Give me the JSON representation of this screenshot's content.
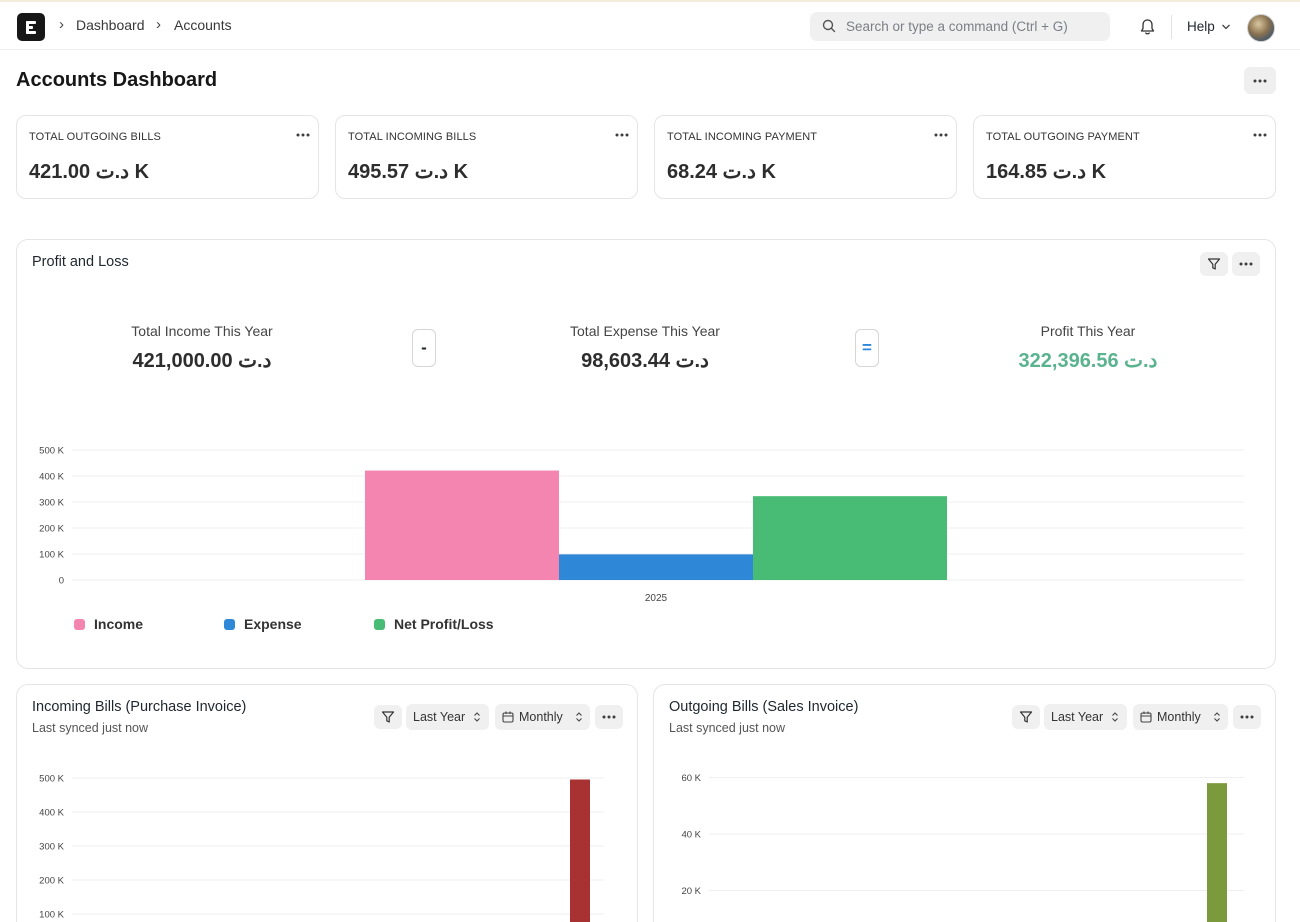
{
  "breadcrumb": {
    "items": [
      "Dashboard",
      "Accounts"
    ]
  },
  "search": {
    "placeholder": "Search or type a command (Ctrl + G)"
  },
  "header": {
    "help_label": "Help"
  },
  "page": {
    "title": "Accounts Dashboard"
  },
  "number_cards": [
    {
      "label": "TOTAL OUTGOING BILLS",
      "value": "421.00 د.ت K"
    },
    {
      "label": "TOTAL INCOMING BILLS",
      "value": "495.57 د.ت K"
    },
    {
      "label": "TOTAL INCOMING PAYMENT",
      "value": "68.24 د.ت K"
    },
    {
      "label": "TOTAL OUTGOING PAYMENT",
      "value": "164.85 د.ت K"
    }
  ],
  "profit_loss": {
    "title": "Profit and Loss",
    "income_label": "Total Income This Year",
    "income_value": "421,000.00 د.ت",
    "minus_sign": "-",
    "expense_label": "Total Expense This Year",
    "expense_value": "98,603.44 د.ت",
    "equals_sign": "=",
    "profit_label": "Profit This Year",
    "profit_value": "322,396.56 د.ت",
    "colors": {
      "profit_text": "#5ab38f",
      "equals": "#2f87d8"
    }
  },
  "incoming_bills": {
    "title": "Incoming Bills (Purchase Invoice)",
    "synced": "Last synced just now",
    "period": "Last Year",
    "interval": "Monthly"
  },
  "outgoing_bills": {
    "title": "Outgoing Bills (Sales Invoice)",
    "synced": "Last synced just now",
    "period": "Last Year",
    "interval": "Monthly"
  },
  "chart_data": [
    {
      "type": "bar",
      "categories": [
        "2025"
      ],
      "series": [
        {
          "name": "Income",
          "values": [
            421000
          ],
          "color": "#f485b1"
        },
        {
          "name": "Expense",
          "values": [
            98603.44
          ],
          "color": "#2f87d8"
        },
        {
          "name": "Net Profit/Loss",
          "values": [
            322396.56
          ],
          "color": "#48bb74"
        }
      ],
      "yticks": [
        "0",
        "100 K",
        "200 K",
        "300 K",
        "400 K",
        "500 K"
      ],
      "ylim": [
        0,
        500000
      ],
      "grid": true,
      "legend": "bottom"
    },
    {
      "type": "bar",
      "series": [
        {
          "values": [
            495570
          ],
          "color": "#a83232"
        }
      ],
      "yticks_visible": [
        "100 K",
        "200 K",
        "300 K",
        "400 K",
        "500 K"
      ],
      "ylim": [
        0,
        500000
      ],
      "grid": true
    },
    {
      "type": "bar",
      "series": [
        {
          "values": [
            58000
          ],
          "color": "#7a9a3d"
        }
      ],
      "yticks_visible": [
        "20 K",
        "40 K",
        "60 K"
      ],
      "ylim": [
        0,
        60000
      ],
      "grid": true
    }
  ]
}
